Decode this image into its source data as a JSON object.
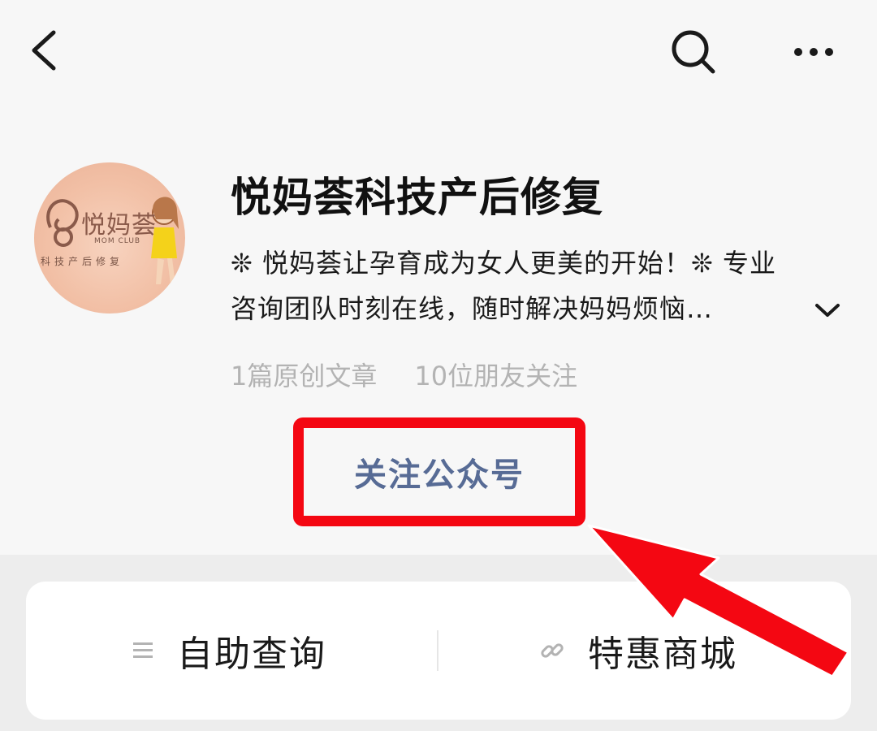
{
  "nav": {
    "back_icon": "chevron-left-icon",
    "search_icon": "search-icon",
    "more_icon": "more-horizontal-icon"
  },
  "account": {
    "avatar_brand": "悦妈荟",
    "avatar_sub": "MOM CLUB",
    "avatar_tag": "科技产后修复",
    "name": "悦妈荟科技产后修复",
    "description_line1": "❊ 悦妈荟让孕育成为女人更美的开始！❊ 专业",
    "description_line2": "咨询团队时刻在线，随时解决妈妈烦恼…",
    "stat_articles": "1篇原创文章",
    "stat_followers": "10位朋友关注",
    "follow_label": "关注公众号"
  },
  "menu": {
    "items": [
      {
        "label": "自助查询",
        "icon": "list-icon"
      },
      {
        "label": "特惠商城",
        "icon": "link-icon"
      }
    ]
  },
  "colors": {
    "highlight": "#f40712",
    "follow_text": "#576b95",
    "stats_text": "#b3b3b3"
  }
}
